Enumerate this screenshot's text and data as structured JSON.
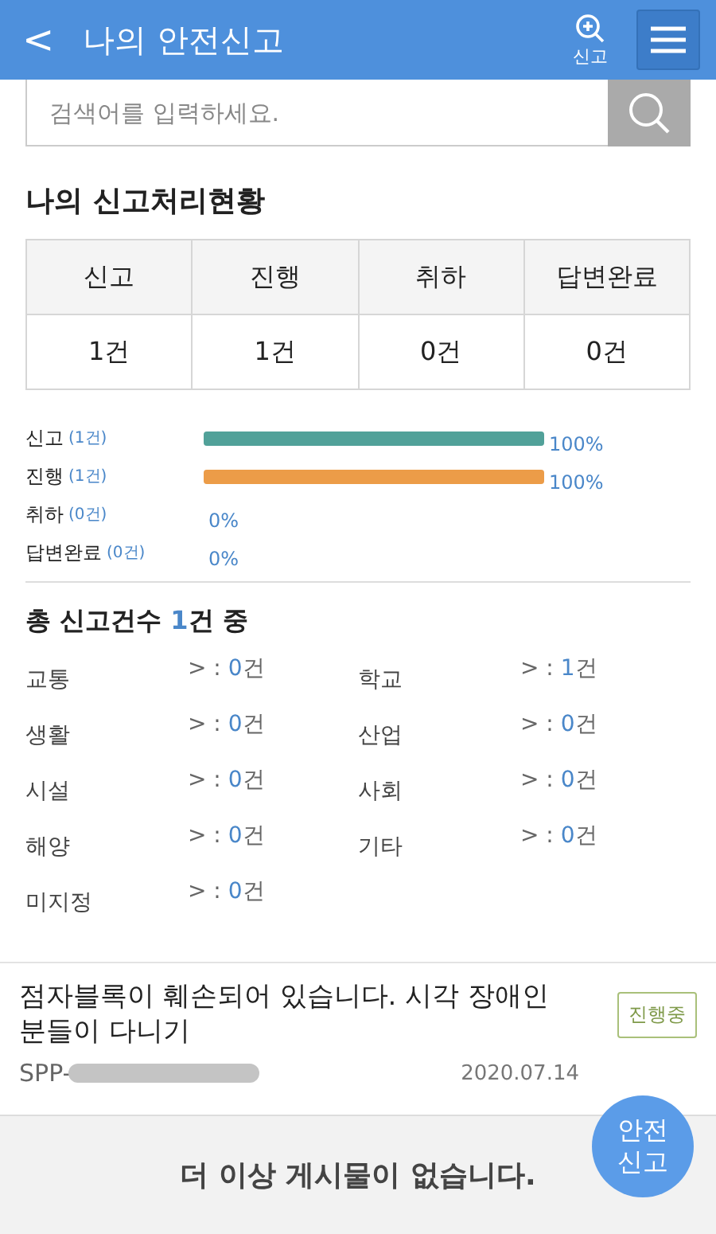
{
  "header": {
    "back": "<",
    "title": "나의 안전신고",
    "report_label": "신고"
  },
  "search": {
    "placeholder": "검색어를 입력하세요."
  },
  "status_title": "나의 신고처리현황",
  "status_table": {
    "columns": [
      "신고",
      "진행",
      "취하",
      "답변완료"
    ],
    "values": [
      "1건",
      "1건",
      "0건",
      "0건"
    ]
  },
  "bars": [
    {
      "label": "신고",
      "count": "(1건)",
      "level": 1,
      "percent": "100%",
      "color": "#51a199"
    },
    {
      "label": "진행",
      "count": "(1건)",
      "level": 1,
      "percent": "100%",
      "color": "#ec9c48"
    },
    {
      "label": "취하",
      "count": "(0건)",
      "percent": "0%"
    },
    {
      "label": "답변완료",
      "count": "(0건)",
      "percent": "0%"
    }
  ],
  "total": {
    "prefix": "총 신고건수",
    "count": "1",
    "suffix": "건 중"
  },
  "categories": [
    {
      "name": "교통",
      "arrow": "> :",
      "count": "0",
      "unit": "건"
    },
    {
      "name": "학교",
      "arrow": "> :",
      "count": "1",
      "unit": "건"
    },
    {
      "name": "생활",
      "arrow": "> :",
      "count": "0",
      "unit": "건"
    },
    {
      "name": "산업",
      "arrow": "> :",
      "count": "0",
      "unit": "건"
    },
    {
      "name": "시설",
      "arrow": "> :",
      "count": "0",
      "unit": "건"
    },
    {
      "name": "사회",
      "arrow": "> :",
      "count": "0",
      "unit": "건"
    },
    {
      "name": "해양",
      "arrow": "> :",
      "count": "0",
      "unit": "건"
    },
    {
      "name": "기타",
      "arrow": "> :",
      "count": "0",
      "unit": "건"
    },
    {
      "name": "미지정",
      "arrow": "> :",
      "count": "0",
      "unit": "건"
    }
  ],
  "reports": [
    {
      "title": "점자블록이 훼손되어 있습니다. 시각 장애인 분들이 다니기",
      "status": "진행중",
      "id": "SPP-",
      "redacted": true,
      "date": "2020.07.14"
    }
  ],
  "end_message": "더 이상 게시물이 없습니다.",
  "fab": "안전 신고"
}
